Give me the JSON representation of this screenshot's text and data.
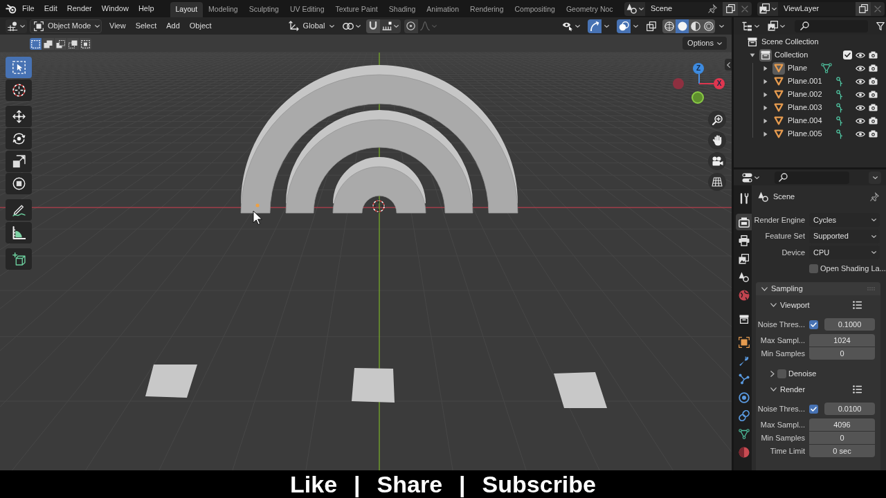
{
  "top_bar": {
    "menus": [
      "File",
      "Edit",
      "Render",
      "Window",
      "Help"
    ],
    "workspaces": [
      {
        "label": "Layout",
        "selected": true
      },
      {
        "label": "Modeling",
        "selected": false
      },
      {
        "label": "Sculpting",
        "selected": false
      },
      {
        "label": "UV Editing",
        "selected": false
      },
      {
        "label": "Texture Paint",
        "selected": false
      },
      {
        "label": "Shading",
        "selected": false
      },
      {
        "label": "Animation",
        "selected": false
      },
      {
        "label": "Rendering",
        "selected": false
      },
      {
        "label": "Compositing",
        "selected": false
      },
      {
        "label": "Geometry Noc",
        "selected": false
      }
    ],
    "scene": "Scene",
    "view_layer": "ViewLayer"
  },
  "viewport_header": {
    "mode": "Object Mode",
    "menus": [
      "View",
      "Select",
      "Add",
      "Object"
    ],
    "orientation": "Global",
    "snap": {
      "on": false
    },
    "proportional_editing": {
      "on": false
    },
    "gizmos": {
      "on": true
    },
    "overlays": {
      "on": true
    },
    "xray": {
      "on": false
    },
    "shading_modes": [
      {
        "kind": "wireframe",
        "selected": false
      },
      {
        "kind": "solid",
        "selected": true
      },
      {
        "kind": "material",
        "selected": false
      },
      {
        "kind": "rendered",
        "selected": false
      }
    ]
  },
  "viewport": {
    "selection_modes": [
      {
        "kind": "new",
        "selected": true
      },
      {
        "kind": "extend",
        "selected": false
      },
      {
        "kind": "subtract",
        "selected": false
      },
      {
        "kind": "invert",
        "selected": false
      },
      {
        "kind": "intersect",
        "selected": false
      }
    ],
    "options": "Options",
    "tool_groups": [
      {
        "tools": [
          {
            "kind": "select-box",
            "selected": true
          },
          {
            "kind": "cursor",
            "selected": false
          }
        ]
      },
      {
        "tools": [
          {
            "kind": "move",
            "selected": false
          },
          {
            "kind": "rotate",
            "selected": false
          },
          {
            "kind": "scale",
            "selected": false
          },
          {
            "kind": "transform",
            "selected": false
          }
        ]
      },
      {
        "tools": [
          {
            "kind": "annotate",
            "selected": false
          },
          {
            "kind": "measure",
            "selected": false
          }
        ]
      },
      {
        "tools": [
          {
            "kind": "add-cube",
            "selected": false
          }
        ]
      }
    ],
    "gizmo_axes": [
      {
        "kind": "z",
        "label": "Z"
      },
      {
        "kind": "x",
        "label": "X"
      },
      {
        "kind": "neg-x"
      },
      {
        "kind": "y"
      }
    ]
  },
  "outliner": {
    "items": [
      {
        "label": "Scene Collection",
        "kind": "scene-collection",
        "children": [
          {
            "label": "Collection",
            "kind": "collection",
            "expanded": true,
            "selected": true,
            "checked": true,
            "visible": true,
            "renderable": true,
            "children": [
              {
                "label": "Plane",
                "kind": "object",
                "expanded": false,
                "selected": true,
                "data": {
                  "kind": "mesh"
                },
                "visible": true,
                "renderable": true
              },
              {
                "label": "Plane.001",
                "kind": "object",
                "expanded": false,
                "selected": false,
                "data": {
                  "kind": "hook"
                },
                "visible": true,
                "renderable": true
              },
              {
                "label": "Plane.002",
                "kind": "object",
                "expanded": false,
                "selected": false,
                "data": {
                  "kind": "hook"
                },
                "visible": true,
                "renderable": true
              },
              {
                "label": "Plane.003",
                "kind": "object",
                "expanded": false,
                "selected": false,
                "data": {
                  "kind": "hook"
                },
                "visible": true,
                "renderable": true
              },
              {
                "label": "Plane.004",
                "kind": "object",
                "expanded": false,
                "selected": false,
                "data": {
                  "kind": "hook"
                },
                "visible": true,
                "renderable": true
              },
              {
                "label": "Plane.005",
                "kind": "object",
                "expanded": false,
                "selected": false,
                "data": {
                  "kind": "hook"
                },
                "visible": true,
                "renderable": true
              }
            ]
          }
        ]
      }
    ]
  },
  "properties": {
    "tab_groups": [
      {
        "tabs": [
          {
            "kind": "tool",
            "selected": false
          }
        ]
      },
      {
        "tabs": [
          {
            "kind": "render",
            "selected": true
          },
          {
            "kind": "output",
            "selected": false
          },
          {
            "kind": "view-layer",
            "selected": false
          },
          {
            "kind": "scene",
            "selected": false
          },
          {
            "kind": "world",
            "selected": false
          }
        ]
      },
      {
        "tabs": [
          {
            "kind": "collection",
            "selected": false
          }
        ]
      },
      {
        "tabs": [
          {
            "kind": "object",
            "selected": false
          },
          {
            "kind": "modifiers",
            "selected": false
          },
          {
            "kind": "particles",
            "selected": false
          },
          {
            "kind": "physics",
            "selected": false
          },
          {
            "kind": "constraints",
            "selected": false
          },
          {
            "kind": "data",
            "selected": false
          },
          {
            "kind": "material",
            "selected": false
          }
        ]
      }
    ],
    "context": "Scene",
    "fields": [
      {
        "label": "Render Engine",
        "value": "Cycles"
      },
      {
        "label": "Feature Set",
        "value": "Supported"
      },
      {
        "label": "Device",
        "value": "CPU"
      }
    ],
    "open_shading_language": {
      "label": "Open Shading La...",
      "checked": false
    },
    "panels": [
      {
        "title": "Sampling",
        "expanded": true,
        "subpanels": [
          {
            "title": "Viewport",
            "kind": "presets",
            "expanded": true,
            "rows": [
              {
                "kind": "toggle-number",
                "label": "Noise Thres...",
                "checked": true,
                "value": "0.1000"
              },
              {
                "kind": "number",
                "label": "Max Sampl...",
                "value": "1024"
              },
              {
                "kind": "number",
                "label": "Min Samples",
                "value": "0"
              }
            ]
          },
          {
            "title": "Denoise",
            "kind": "toggle",
            "expanded": false,
            "checked": false
          },
          {
            "title": "Render",
            "kind": "presets",
            "expanded": true,
            "rows": [
              {
                "kind": "toggle-number",
                "label": "Noise Thres...",
                "checked": true,
                "value": "0.0100"
              },
              {
                "kind": "number",
                "label": "Max Sampl...",
                "value": "4096"
              },
              {
                "kind": "number",
                "label": "Min Samples",
                "value": "0"
              },
              {
                "kind": "number",
                "label": "Time Limit",
                "value": "0 sec"
              }
            ]
          }
        ]
      }
    ]
  },
  "caption": [
    "Like",
    "|",
    "Share",
    "|",
    "Subscribe"
  ]
}
